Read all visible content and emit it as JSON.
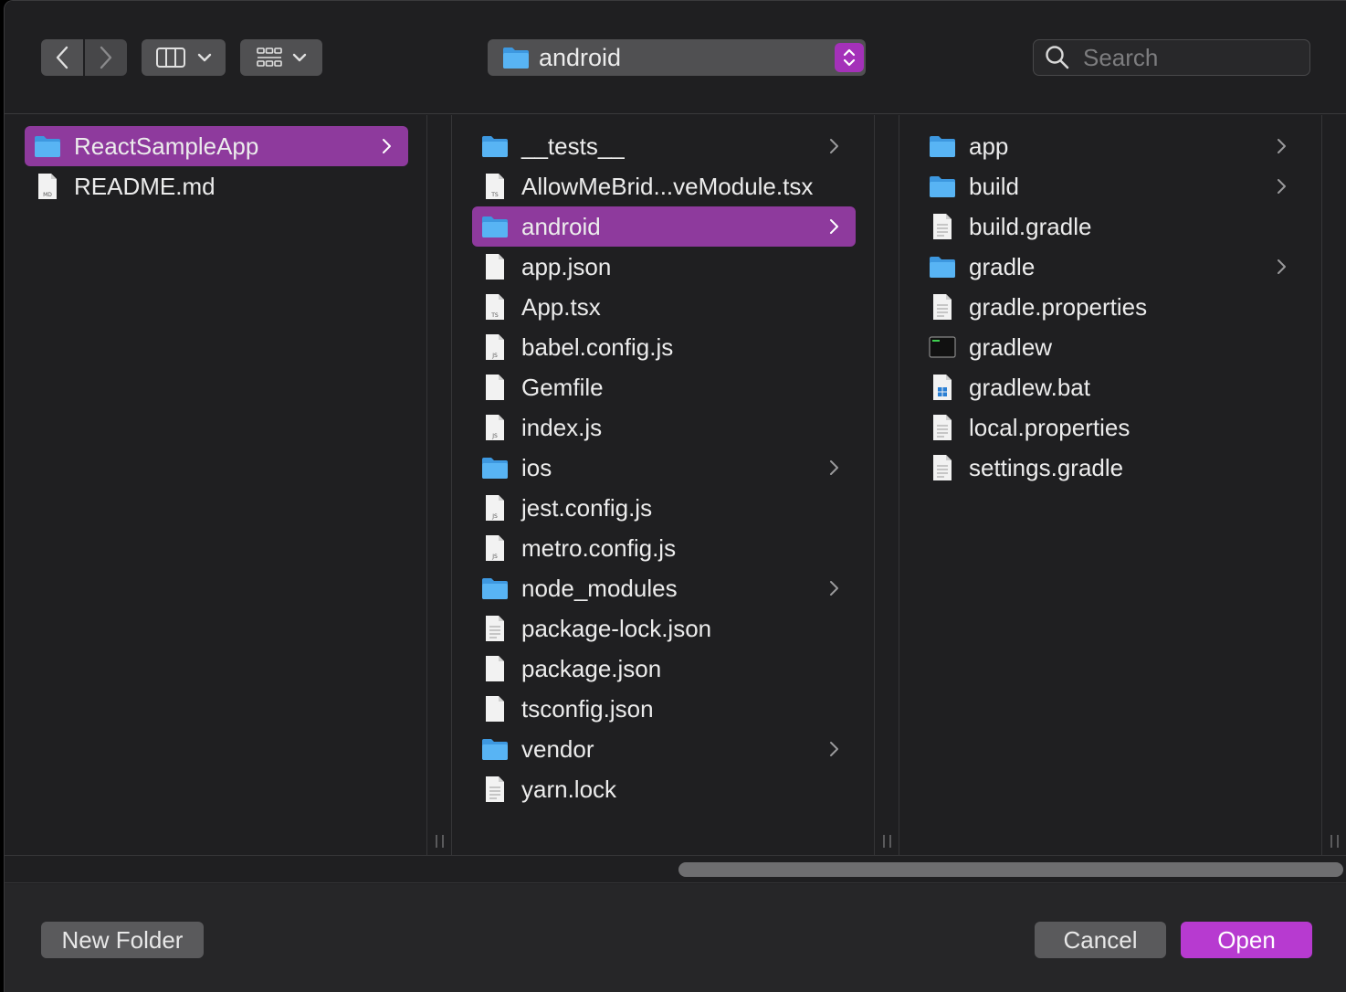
{
  "toolbar": {
    "path_label": "android",
    "search_placeholder": "Search"
  },
  "columns": [
    {
      "items": [
        {
          "label": "ReactSampleApp",
          "type": "folder",
          "selected": true,
          "has_children": true
        },
        {
          "label": "README.md",
          "type": "md",
          "selected": false,
          "has_children": false
        }
      ]
    },
    {
      "items": [
        {
          "label": "__tests__",
          "type": "folder",
          "selected": false,
          "has_children": true
        },
        {
          "label": "AllowMeBrid...veModule.tsx",
          "type": "ts",
          "selected": false,
          "has_children": false
        },
        {
          "label": "android",
          "type": "folder",
          "selected": true,
          "has_children": true
        },
        {
          "label": "app.json",
          "type": "blank",
          "selected": false,
          "has_children": false
        },
        {
          "label": "App.tsx",
          "type": "ts",
          "selected": false,
          "has_children": false
        },
        {
          "label": "babel.config.js",
          "type": "js",
          "selected": false,
          "has_children": false
        },
        {
          "label": "Gemfile",
          "type": "blank",
          "selected": false,
          "has_children": false
        },
        {
          "label": "index.js",
          "type": "js",
          "selected": false,
          "has_children": false
        },
        {
          "label": "ios",
          "type": "folder",
          "selected": false,
          "has_children": true
        },
        {
          "label": "jest.config.js",
          "type": "js",
          "selected": false,
          "has_children": false
        },
        {
          "label": "metro.config.js",
          "type": "js",
          "selected": false,
          "has_children": false
        },
        {
          "label": "node_modules",
          "type": "folder",
          "selected": false,
          "has_children": true
        },
        {
          "label": "package-lock.json",
          "type": "text",
          "selected": false,
          "has_children": false
        },
        {
          "label": "package.json",
          "type": "blank",
          "selected": false,
          "has_children": false
        },
        {
          "label": "tsconfig.json",
          "type": "blank",
          "selected": false,
          "has_children": false
        },
        {
          "label": "vendor",
          "type": "folder",
          "selected": false,
          "has_children": true
        },
        {
          "label": "yarn.lock",
          "type": "text",
          "selected": false,
          "has_children": false
        }
      ]
    },
    {
      "items": [
        {
          "label": "app",
          "type": "folder",
          "selected": false,
          "has_children": true
        },
        {
          "label": "build",
          "type": "folder",
          "selected": false,
          "has_children": true
        },
        {
          "label": "build.gradle",
          "type": "text",
          "selected": false,
          "has_children": false
        },
        {
          "label": "gradle",
          "type": "folder",
          "selected": false,
          "has_children": true
        },
        {
          "label": "gradle.properties",
          "type": "text",
          "selected": false,
          "has_children": false
        },
        {
          "label": "gradlew",
          "type": "exec",
          "selected": false,
          "has_children": false
        },
        {
          "label": "gradlew.bat",
          "type": "bat",
          "selected": false,
          "has_children": false
        },
        {
          "label": "local.properties",
          "type": "text",
          "selected": false,
          "has_children": false
        },
        {
          "label": "settings.gradle",
          "type": "text",
          "selected": false,
          "has_children": false
        }
      ]
    }
  ],
  "footer": {
    "new_folder_label": "New Folder",
    "cancel_label": "Cancel",
    "open_label": "Open"
  },
  "colors": {
    "accent": "#b73ad0",
    "selection": "#8e3a9d",
    "folder": "#4aa8f0"
  }
}
